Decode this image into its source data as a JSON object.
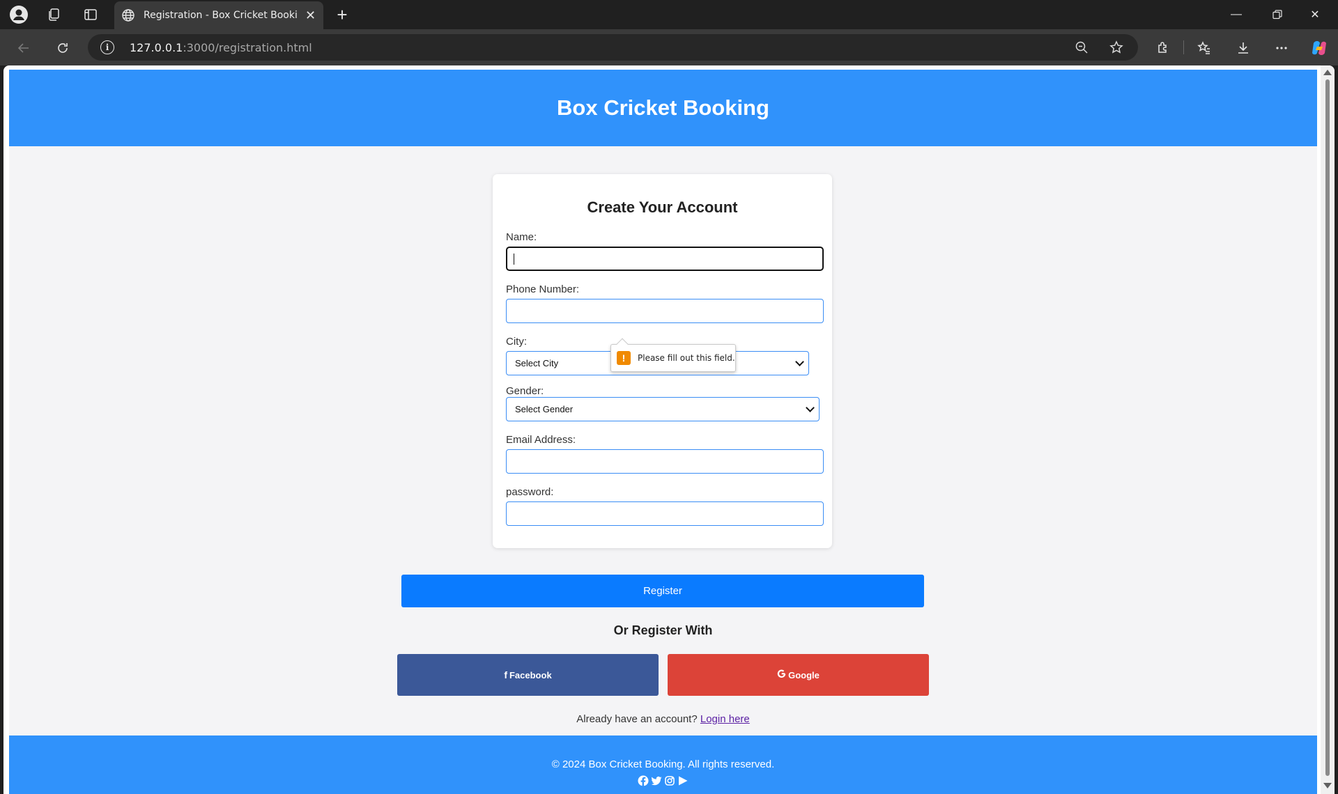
{
  "browser": {
    "tab_title": "Registration - Box Cricket Booking",
    "url_host": "127.0.0.1",
    "url_path": ":3000/registration.html"
  },
  "header": {
    "title": "Box Cricket Booking"
  },
  "form": {
    "title": "Create Your Account",
    "name_label": "Name:",
    "name_value": "",
    "phone_label": "Phone Number:",
    "city_label": "City:",
    "city_selected": "Select City",
    "gender_label": "Gender:",
    "gender_selected": "Select Gender",
    "email_label": "Email Address:",
    "password_label": "password:"
  },
  "validation": {
    "message": "Please fill out this field."
  },
  "actions": {
    "register_label": "Register",
    "or_text": "Or Register With",
    "facebook_label": "Facebook",
    "google_label": "Google",
    "login_prompt": "Already have an account?",
    "login_link": "Login here"
  },
  "footer": {
    "copyright": "© 2024 Box Cricket Booking. All rights reserved.",
    "social_icons": [
      "facebook-icon",
      "twitter-icon",
      "instagram-icon",
      "play-icon"
    ]
  },
  "colors": {
    "header_bg": "#3092fb",
    "register_bg": "#0a7bff",
    "facebook_bg": "#3b5898",
    "google_bg": "#dc4338",
    "page_bg": "#f4f4f6"
  }
}
